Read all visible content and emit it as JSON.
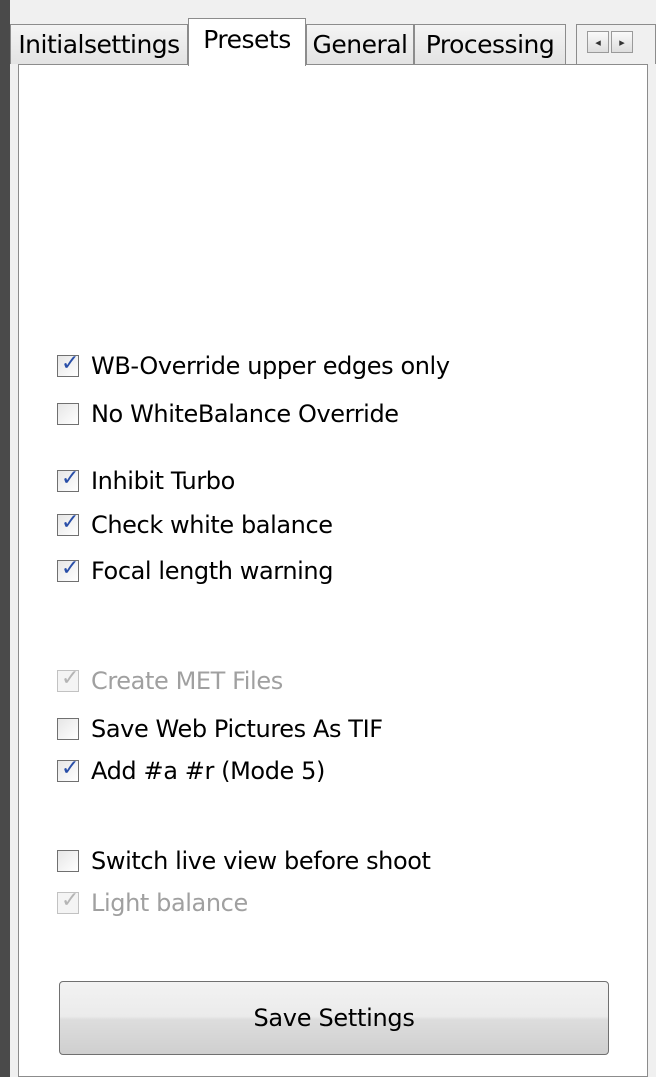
{
  "tabs": [
    {
      "label": "Initialsettings",
      "active": false
    },
    {
      "label": "Presets",
      "active": true
    },
    {
      "label": "General",
      "active": false
    },
    {
      "label": "Processing",
      "active": false
    }
  ],
  "tab_scroll": {
    "left_icon": "scroll-left-icon",
    "right_icon": "scroll-right-icon",
    "left_glyph": "◂",
    "right_glyph": "▸"
  },
  "checkboxes": [
    {
      "label": "WB-Override upper edges only",
      "checked": true,
      "enabled": true
    },
    {
      "label": "No WhiteBalance Override",
      "checked": false,
      "enabled": true
    },
    {
      "label": "Inhibit Turbo",
      "checked": true,
      "enabled": true
    },
    {
      "label": "Check white balance",
      "checked": true,
      "enabled": true
    },
    {
      "label": "Focal length warning",
      "checked": true,
      "enabled": true
    },
    {
      "label": "Create MET Files",
      "checked": true,
      "enabled": false
    },
    {
      "label": "Save Web Pictures As TIF",
      "checked": false,
      "enabled": true
    },
    {
      "label": "Add #a #r (Mode 5)",
      "checked": true,
      "enabled": true
    },
    {
      "label": "Switch live view before shoot",
      "checked": false,
      "enabled": true
    },
    {
      "label": "Light balance",
      "checked": true,
      "enabled": false
    }
  ],
  "save_button": {
    "label": "Save Settings"
  },
  "colors": {
    "check": "#2a4fa8",
    "disabled_text": "#a0a0a0",
    "background": "#4a4a4a"
  }
}
